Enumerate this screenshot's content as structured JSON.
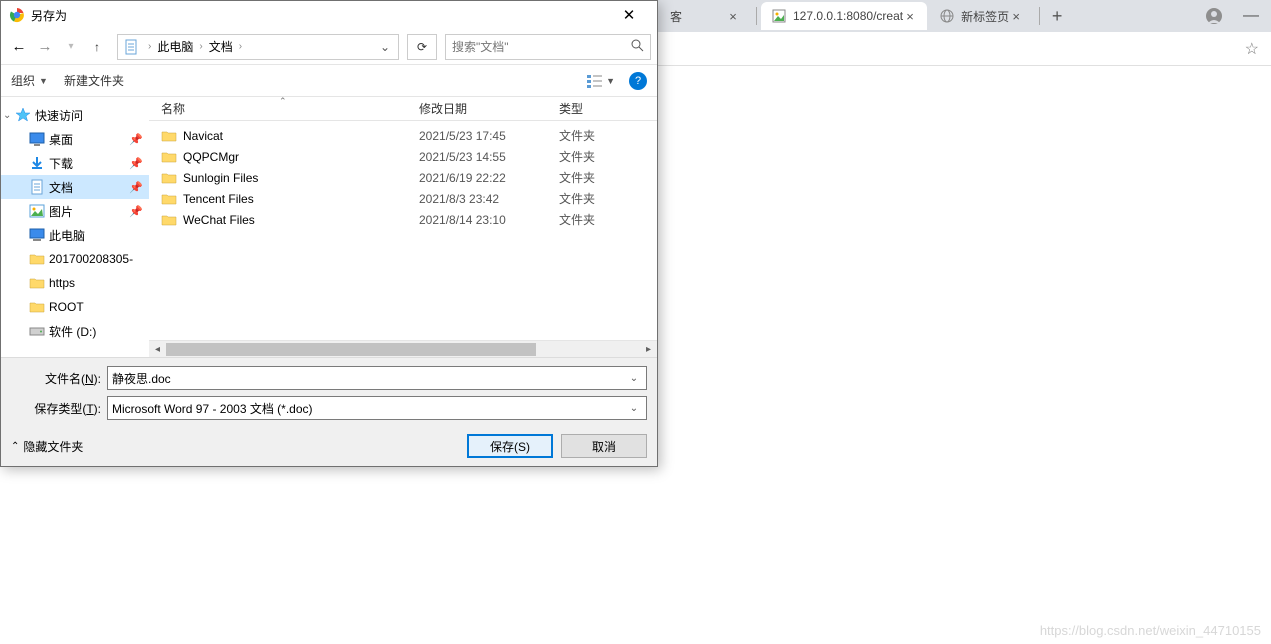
{
  "browser": {
    "tabs": [
      {
        "title": "客",
        "fav": "csdn"
      },
      {
        "title": "127.0.0.1:8080/creat",
        "fav": "img"
      },
      {
        "title": "新标签页",
        "fav": "globe"
      }
    ]
  },
  "dialog": {
    "title": "另存为",
    "breadcrumb": {
      "root": "此电脑",
      "folder": "文档"
    },
    "search_placeholder": "搜索\"文档\"",
    "toolbar": {
      "organize": "组织",
      "new_folder": "新建文件夹"
    },
    "columns": {
      "name": "名称",
      "date": "修改日期",
      "type": "类型"
    },
    "nav": [
      {
        "label": "快速访问",
        "icon": "star",
        "exp": true
      },
      {
        "label": "桌面",
        "icon": "desktop",
        "sub": true,
        "pin": true
      },
      {
        "label": "下载",
        "icon": "download",
        "sub": true,
        "pin": true
      },
      {
        "label": "文档",
        "icon": "doc",
        "sub": true,
        "pin": true,
        "selected": true
      },
      {
        "label": "图片",
        "icon": "pic",
        "sub": true,
        "pin": true
      },
      {
        "label": "此电脑",
        "icon": "pc",
        "sub": true
      },
      {
        "label": "201700208305-",
        "icon": "folder",
        "sub": true
      },
      {
        "label": "https",
        "icon": "folder",
        "sub": true
      },
      {
        "label": "ROOT",
        "icon": "folder",
        "sub": true
      },
      {
        "label": "软件 (D:)",
        "icon": "drive",
        "sub": true
      }
    ],
    "files": [
      {
        "name": "Navicat",
        "date": "2021/5/23 17:45",
        "type": "文件夹"
      },
      {
        "name": "QQPCMgr",
        "date": "2021/5/23 14:55",
        "type": "文件夹"
      },
      {
        "name": "Sunlogin Files",
        "date": "2021/6/19 22:22",
        "type": "文件夹"
      },
      {
        "name": "Tencent Files",
        "date": "2021/8/3 23:42",
        "type": "文件夹"
      },
      {
        "name": "WeChat Files",
        "date": "2021/8/14 23:10",
        "type": "文件夹"
      }
    ],
    "filename_label": "文件名(N):",
    "filetype_label": "保存类型(T):",
    "filename_value": "静夜思.doc",
    "filetype_value": "Microsoft Word 97 - 2003 文档 (*.doc)",
    "hide_folders": "隐藏文件夹",
    "save_btn": "保存(S)",
    "cancel_btn": "取消"
  },
  "watermark": "https://blog.csdn.net/weixin_44710155"
}
